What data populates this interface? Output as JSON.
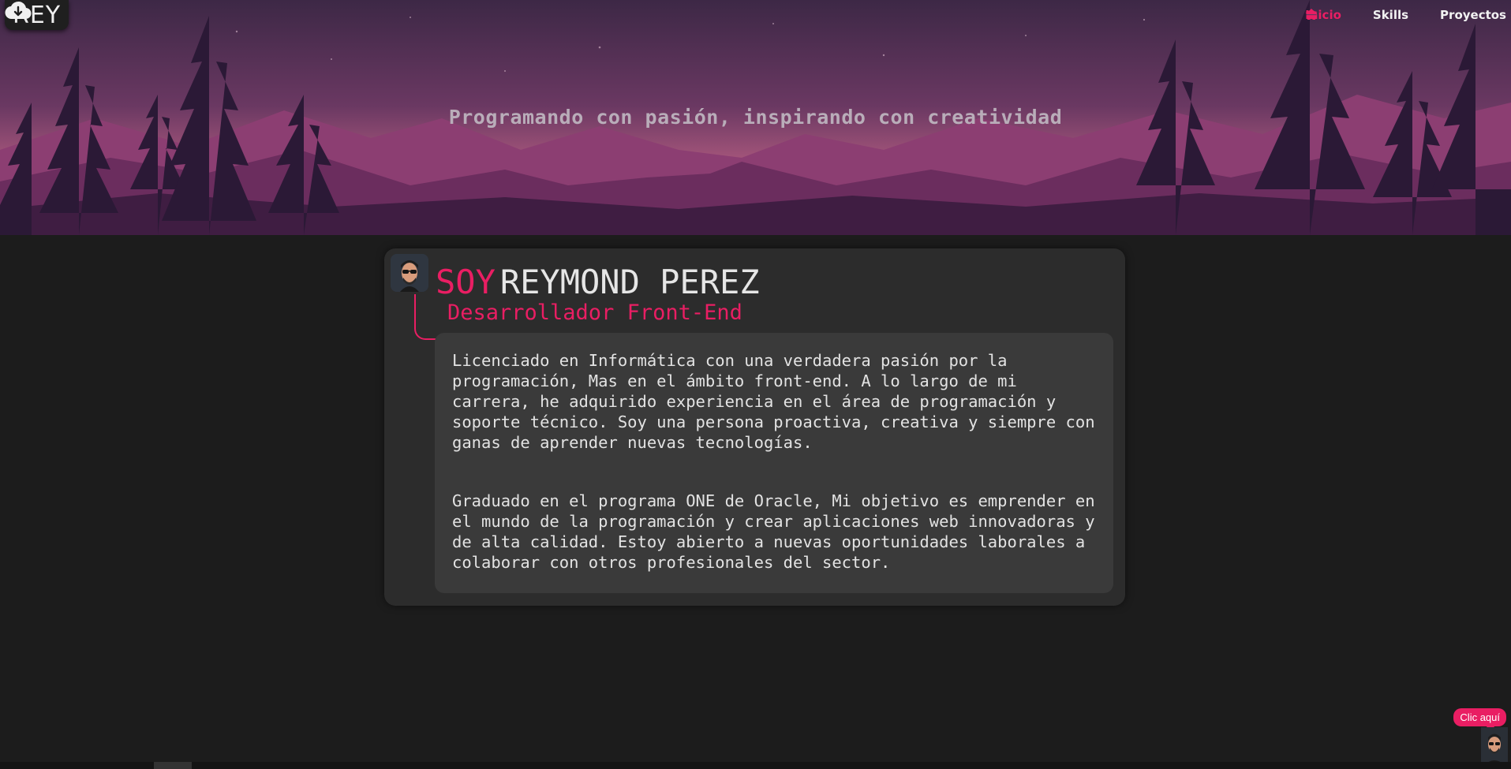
{
  "logo": {
    "text": "REY",
    "icon": "cloud-download-icon"
  },
  "nav": {
    "items": [
      {
        "label": "Inicio",
        "icon": "home-icon",
        "active": true
      },
      {
        "label": "Skills",
        "icon": "graduation-cap-icon",
        "active": false
      },
      {
        "label": "Proyectos",
        "icon": "briefcase-icon",
        "active": false
      }
    ]
  },
  "hero": {
    "tagline": "Programando con pasión, inspirando con creatividad"
  },
  "profile": {
    "prefix": "SOY",
    "name": "REYMOND PEREZ",
    "role": "Desarrollador Front-End",
    "bio": [
      "Licenciado en Informática con una verdadera pasión por la programación, Mas en el ámbito front-end. A lo largo de mi carrera, he adquirido experiencia en el área de programación y soporte técnico. Soy una persona proactiva, creativa y siempre con ganas de aprender nuevas tecnologías.",
      "Graduado en el programa ONE de Oracle, Mi objetivo es emprender en el mundo de la programación y crear aplicaciones web innovadoras y de alta calidad. Estoy abierto a nuevas oportunidades laborales a colaborar con otros profesionales del sector."
    ]
  },
  "chat": {
    "bubble_label": "Clic aquí"
  },
  "colors": {
    "accent": "#e91e63",
    "background": "#1c1c1c",
    "card": "#2c2c2c",
    "bio_box": "#3a3a3a"
  }
}
